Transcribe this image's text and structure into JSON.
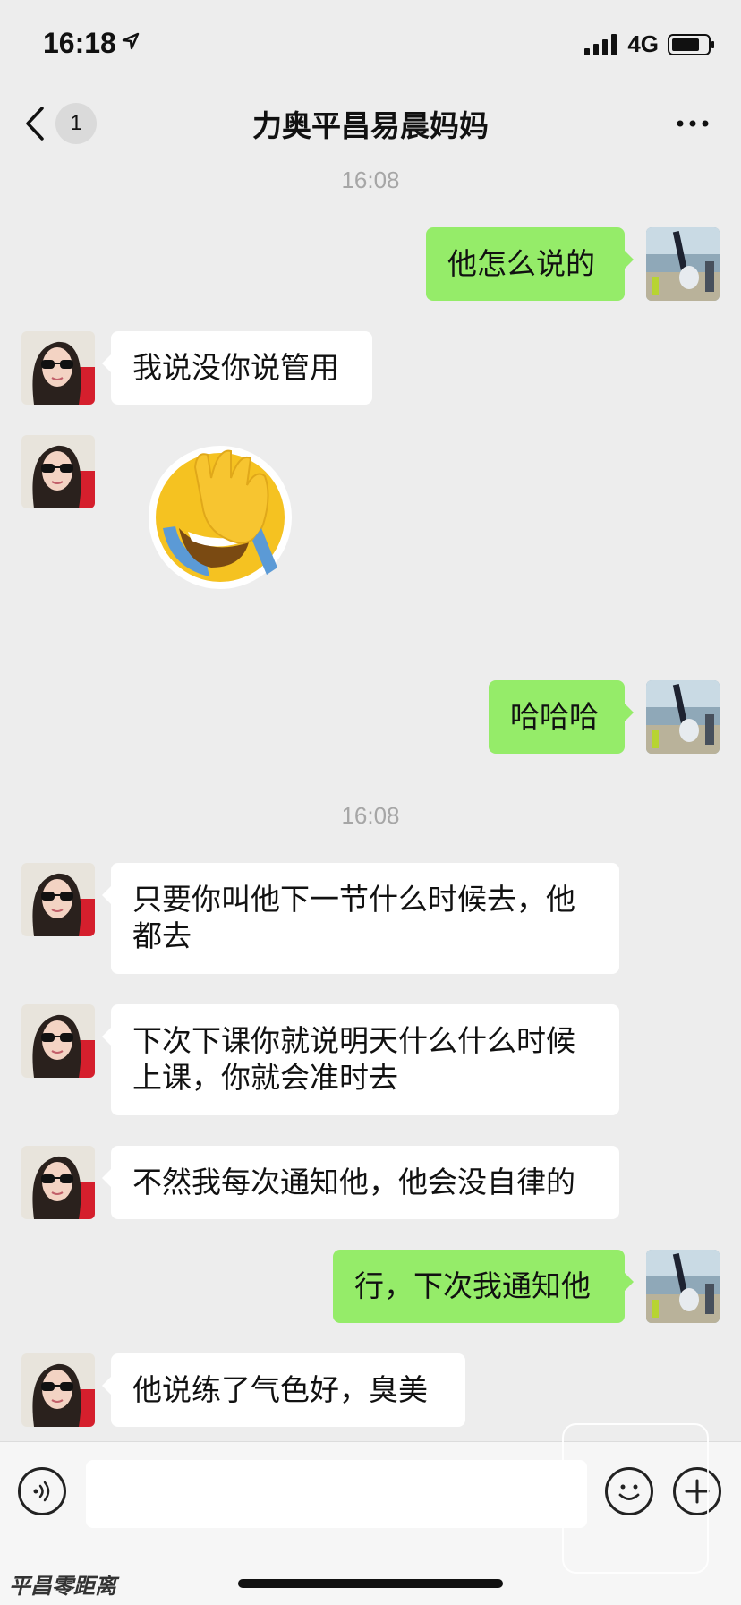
{
  "status_bar": {
    "time": "16:18",
    "network": "4G",
    "battery_level": 0.8
  },
  "nav": {
    "unread_count": "1",
    "title": "力奥平昌易晨妈妈"
  },
  "messages": [
    {
      "type": "time",
      "text": "16:08"
    },
    {
      "type": "text",
      "side": "right",
      "text": "他怎么说的"
    },
    {
      "type": "text",
      "side": "left",
      "text": "我说没你说管用"
    },
    {
      "type": "sticker",
      "side": "left",
      "icon": "facepalm-laughing-sticker"
    },
    {
      "type": "text",
      "side": "right",
      "text": "哈哈哈"
    },
    {
      "type": "time",
      "text": "16:08"
    },
    {
      "type": "text",
      "side": "left",
      "text": "只要你叫他下一节什么时候去，他都去"
    },
    {
      "type": "text",
      "side": "left",
      "text": "下次下课你就说明天什么什么时候上课，你就会准时去"
    },
    {
      "type": "text",
      "side": "left",
      "text": "不然我每次通知他，他会没自律的"
    },
    {
      "type": "text",
      "side": "right",
      "text": "行，下次我通知他"
    },
    {
      "type": "text",
      "side": "left",
      "text": "他说练了气色好，臭美"
    }
  ],
  "input_bar": {
    "value": "",
    "voice_icon": "voice-icon",
    "emoji_icon": "emoji-icon",
    "add_icon": "plus-icon"
  },
  "watermark": {
    "text": "平昌零距离"
  },
  "colors": {
    "self_bubble": "#95ec69",
    "other_bubble": "#ffffff",
    "background": "#ededed"
  }
}
